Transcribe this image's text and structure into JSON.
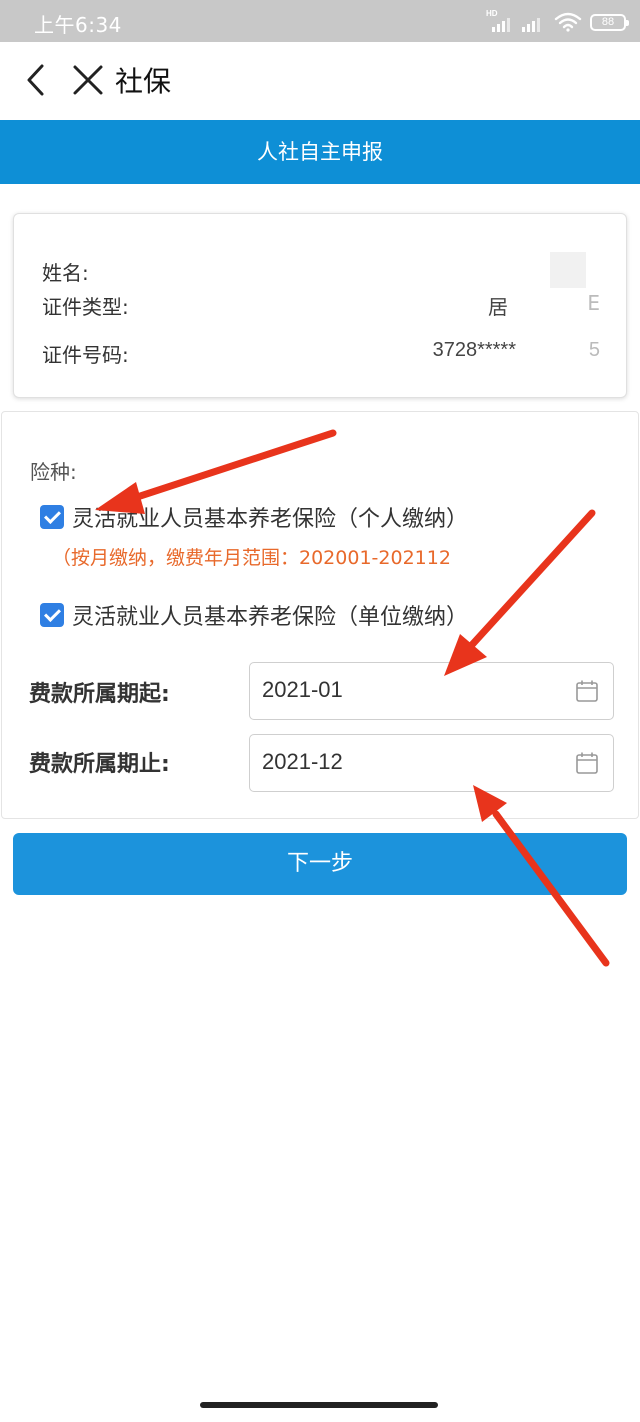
{
  "status_bar": {
    "time": "上午6:34",
    "network": "HD",
    "battery": "88",
    "icons": [
      "hd-signal-icon",
      "signal-icon",
      "wifi-icon",
      "battery-icon"
    ]
  },
  "nav": {
    "title": "社保",
    "icons": [
      "back-chevron-icon",
      "close-icon"
    ]
  },
  "banner": {
    "title": "人社自主申报"
  },
  "info": {
    "name_label": "姓名:",
    "name_value": "",
    "id_type_label": "证件类型:",
    "id_type_value": "居",
    "id_type_value_end": "E",
    "id_number_label": "证件号码:",
    "id_number_value": "3728*****",
    "id_number_value_end": "5"
  },
  "form": {
    "insurance_label": "险种:",
    "options": [
      {
        "label": "灵活就业人员基本养老保险（个人缴纳）",
        "checked": true
      },
      {
        "label": "灵活就业人员基本养老保险（单位缴纳）",
        "checked": true
      }
    ],
    "note": "（按月缴纳，缴费年月范围：202001-202112",
    "period_start_label": "费款所属期起:",
    "period_start_value": "2021-01",
    "period_end_label": "费款所属期止:",
    "period_end_value": "2021-12"
  },
  "next_button": {
    "label": "下一步"
  },
  "colors": {
    "banner": "#0e8fd6",
    "button": "#1c93dc",
    "checkbox": "#2f7fe3",
    "note": "#e8692b",
    "annotation_arrow": "#e8341c"
  }
}
